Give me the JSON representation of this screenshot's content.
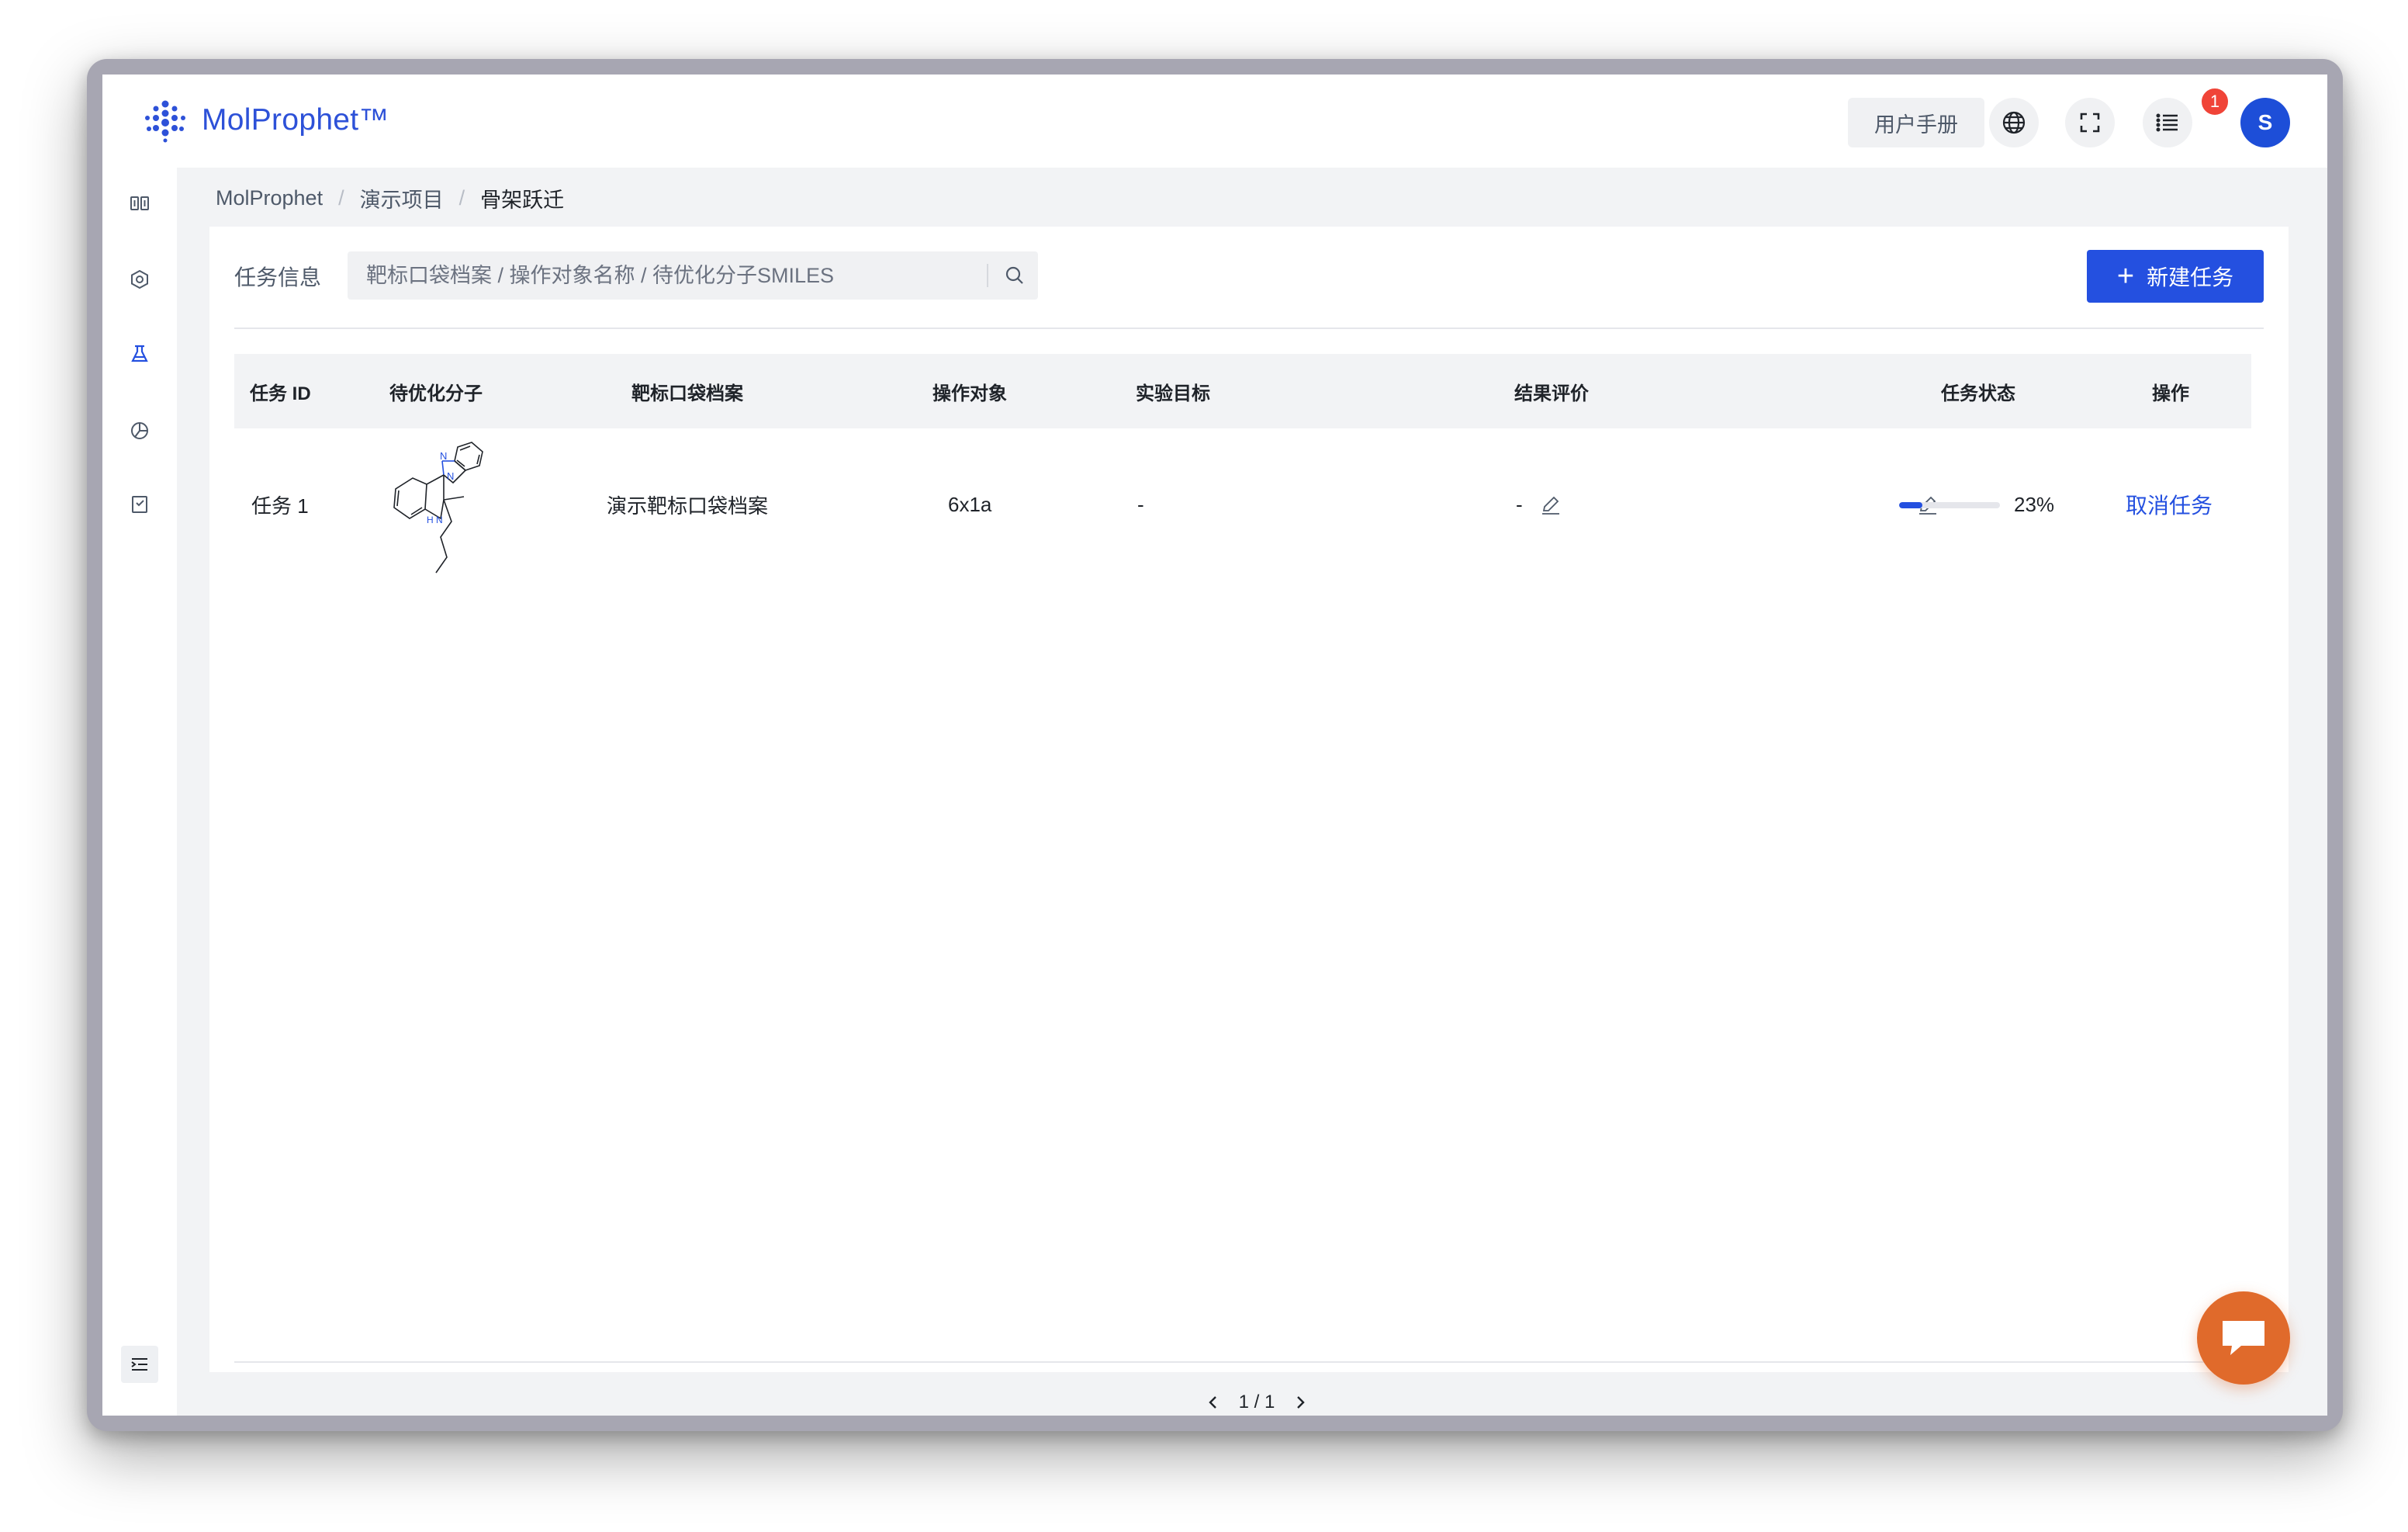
{
  "app": {
    "name": "MolProphet™"
  },
  "header": {
    "manual_label": "用户手册",
    "notification_count": "1",
    "avatar_letter": "S"
  },
  "breadcrumb": [
    "MolProphet",
    "演示项目",
    "骨架跃迁"
  ],
  "filter": {
    "label": "任务信息",
    "placeholder": "靶标口袋档案 / 操作对象名称 / 待优化分子SMILES"
  },
  "new_task_label": "新建任务",
  "table": {
    "headers": [
      "任务 ID",
      "待优化分子",
      "靶标口袋档案",
      "操作对象",
      "实验目标",
      "结果评价",
      "任务状态",
      "操作"
    ],
    "rows": [
      {
        "id": "任务 1",
        "pocket": "演示靶标口袋档案",
        "target": "6x1a",
        "goal": "-",
        "result": "-",
        "progress": 0.23,
        "progress_text": "23%",
        "action": "取消任务",
        "atom_n1": "N",
        "atom_n2": "N",
        "atom_nh": "H\nN"
      }
    ]
  },
  "pagination": {
    "text": "1 / 1"
  },
  "colors": {
    "primary": "#2450e0",
    "fab": "#e06a2b",
    "badge": "#f04438"
  }
}
